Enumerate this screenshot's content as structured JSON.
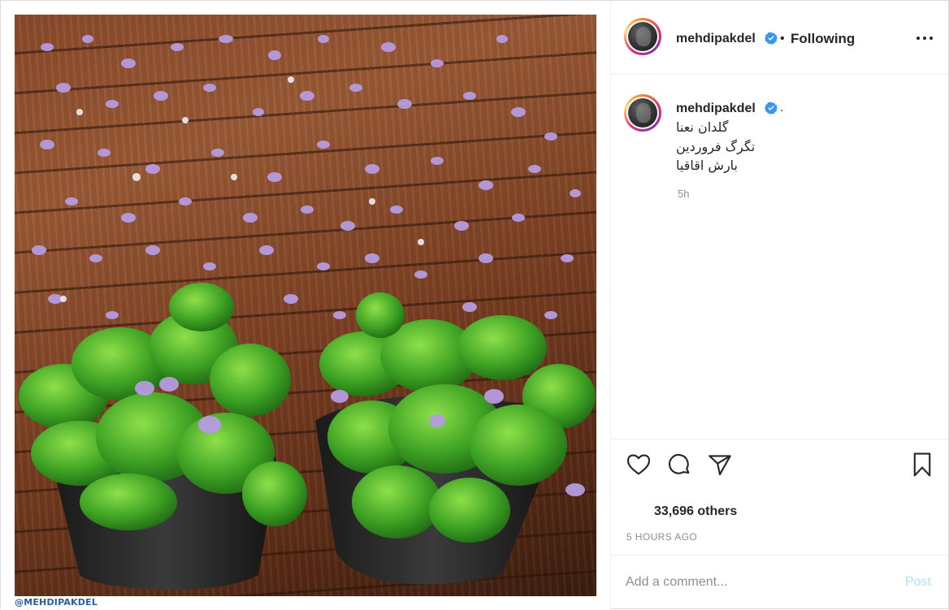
{
  "post": {
    "username": "mehdipakdel",
    "header_dot": "•",
    "following_label": "Following",
    "watermark": "@MEHDIPAKDEL",
    "caption": {
      "username": "mehdipakdel",
      "dot": ".",
      "lines": [
        "گلدان نعنا",
        "تگرگ فروردین",
        "بارش اقاقیا"
      ],
      "time": "5h"
    },
    "likes_text": "33,696 others",
    "timestamp": "5 HOURS AGO",
    "comment": {
      "placeholder": "Add a comment...",
      "post_label": "Post"
    }
  },
  "icons": {
    "verified": "verified-badge-icon",
    "more": "more-options-icon",
    "like": "heart-icon",
    "comment": "comment-icon",
    "share": "share-icon",
    "save": "bookmark-icon"
  },
  "colors": {
    "verified": "#3897f0",
    "post_disabled": "#b2dffc",
    "meta": "#8e8e8e",
    "watermark": "#2a5fa0"
  }
}
